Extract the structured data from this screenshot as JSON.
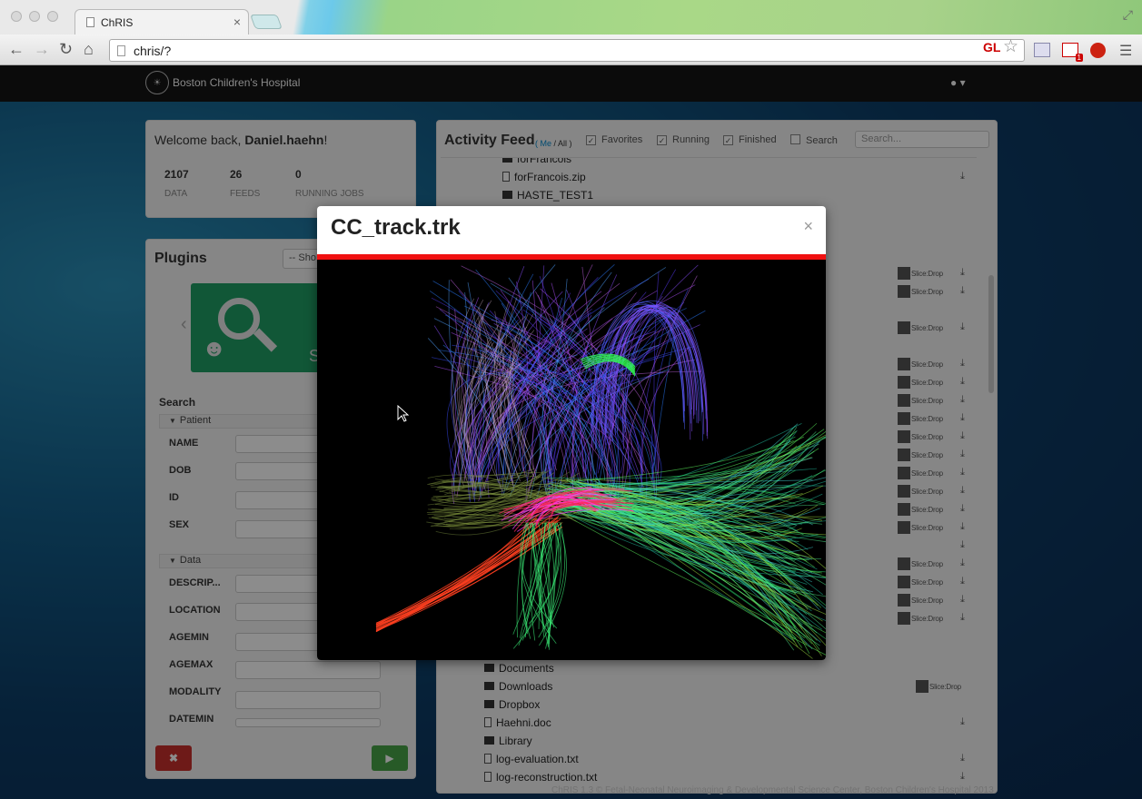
{
  "browser": {
    "tab_title": "ChRIS",
    "tab_close": "×",
    "url": "chris/?",
    "gl_label": "GL",
    "mail_badge": "1"
  },
  "navbar": {
    "brand": "Boston Children's Hospital",
    "user_icon": "user-icon"
  },
  "welcome": {
    "greeting_prefix": "Welcome back, ",
    "username": "Daniel.haehn",
    "greeting_suffix": "!",
    "stats": [
      {
        "value": "2107",
        "label": "DATA"
      },
      {
        "value": "26",
        "label": "FEEDS"
      },
      {
        "value": "0",
        "label": "RUNNING JOBS"
      }
    ]
  },
  "plugins": {
    "title": "Plugins",
    "select_value": "-- Sho",
    "tile_letter": "S",
    "search_title": "Search",
    "patient_legend": "Patient",
    "patient_fields": [
      "NAME",
      "DOB",
      "ID",
      "SEX"
    ],
    "data_legend": "Data",
    "data_fields": [
      "DESCRIP...",
      "LOCATION",
      "AGEMIN",
      "AGEMAX",
      "MODALITY",
      "DATEMIN"
    ],
    "cancel_label": "✖",
    "run_label": "▶"
  },
  "feed": {
    "title": "Activity Feed",
    "scope_me": "( Me",
    "scope_sep": " / ",
    "scope_all": "All",
    "scope_end": " )",
    "filters": [
      {
        "label": "Favorites",
        "checked": true
      },
      {
        "label": "Running",
        "checked": true
      },
      {
        "label": "Finished",
        "checked": true
      },
      {
        "label": "Search",
        "checked": false
      }
    ],
    "search_placeholder": "Search...",
    "slicedrop_label": "Slice:Drop",
    "items_top": [
      {
        "name": "forFrancois",
        "kind": "folder"
      },
      {
        "name": "forFrancois.zip",
        "kind": "file"
      },
      {
        "name": "HASTE_TEST1",
        "kind": "folder"
      }
    ],
    "items_bottom": [
      {
        "name": "Documents",
        "kind": "folder"
      },
      {
        "name": "Downloads",
        "kind": "folder"
      },
      {
        "name": "Dropbox",
        "kind": "folder"
      },
      {
        "name": "Haehni.doc",
        "kind": "file"
      },
      {
        "name": "Library",
        "kind": "folder"
      },
      {
        "name": "log-evaluation.txt",
        "kind": "file"
      },
      {
        "name": "log-reconstruction.txt",
        "kind": "file"
      }
    ]
  },
  "footer": {
    "text": "ChRIS 1.3 © Fetal-Neonatal Neuroimaging & Developmental Science Center, Boston Children's Hospital 2013"
  },
  "modal": {
    "title": "CC_track.trk",
    "close": "×",
    "accent": "#f01010"
  }
}
